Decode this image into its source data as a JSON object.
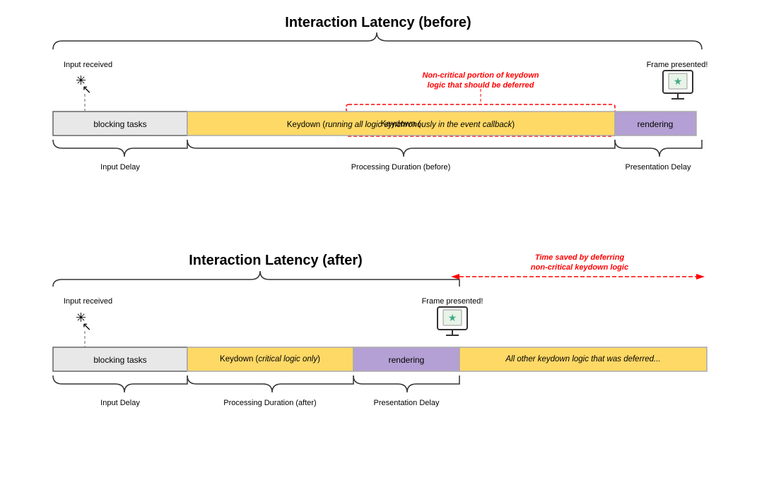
{
  "top": {
    "title": "Interaction Latency (before)",
    "input_label": "Input received",
    "frame_label": "Frame presented!",
    "blocking_label": "blocking tasks",
    "keydown_label": "Keydown (running all logic synchronously in the event callback)",
    "rendering_label": "rendering",
    "annotation_label": "Non-critical portion of keydown\nlogic that should be deferred",
    "input_delay_label": "Input Delay",
    "processing_label": "Processing Duration (before)",
    "presentation_label": "Presentation Delay"
  },
  "bottom": {
    "title": "Interaction Latency (after)",
    "input_label": "Input received",
    "frame_label": "Frame presented!",
    "blocking_label": "blocking tasks",
    "keydown_label": "Keydown (critical logic only)",
    "rendering_label": "rendering",
    "deferred_label": "All other keydown logic that was deferred...",
    "time_saved_label": "Time saved by deferring\nnon-critical keydown logic",
    "input_delay_label": "Input Delay",
    "processing_label": "Processing Duration (after)",
    "presentation_label": "Presentation Delay"
  },
  "colors": {
    "blocking_bg": "#e8e8e8",
    "keydown_bg": "#ffd966",
    "rendering_bg": "#b4a0d4",
    "deferred_bg": "#ffd966",
    "red": "#cc0000",
    "border": "#666666"
  }
}
